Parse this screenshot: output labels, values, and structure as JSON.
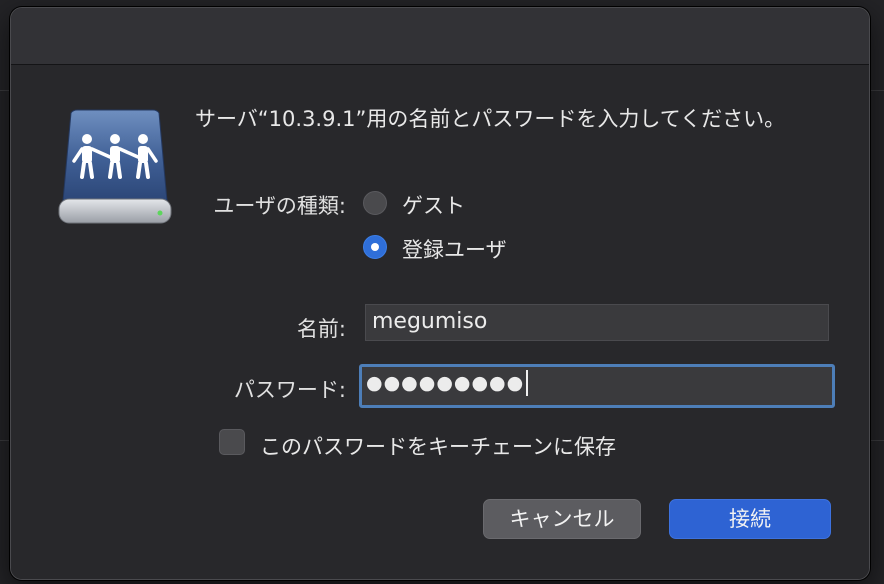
{
  "dialog": {
    "message": "サーバ“10.3.9.1”用の名前とパスワードを入力してください。",
    "user_type": {
      "label": "ユーザの種類:",
      "options": [
        {
          "label": "ゲスト",
          "selected": false
        },
        {
          "label": "登録ユーザ",
          "selected": true
        }
      ]
    },
    "name_field": {
      "label": "名前:",
      "value": "megumiso"
    },
    "password_field": {
      "label": "パスワード:",
      "masked_value": "●●●●●●●●●"
    },
    "keychain_checkbox": {
      "label": "このパスワードをキーチェーンに保存",
      "checked": false
    },
    "buttons": {
      "cancel": "キャンセル",
      "connect": "接続"
    },
    "icon": "network-server-drive-icon",
    "colors": {
      "accent": "#2e63d3",
      "focus_ring": "#4d7eb8",
      "background": "#28282b"
    }
  }
}
